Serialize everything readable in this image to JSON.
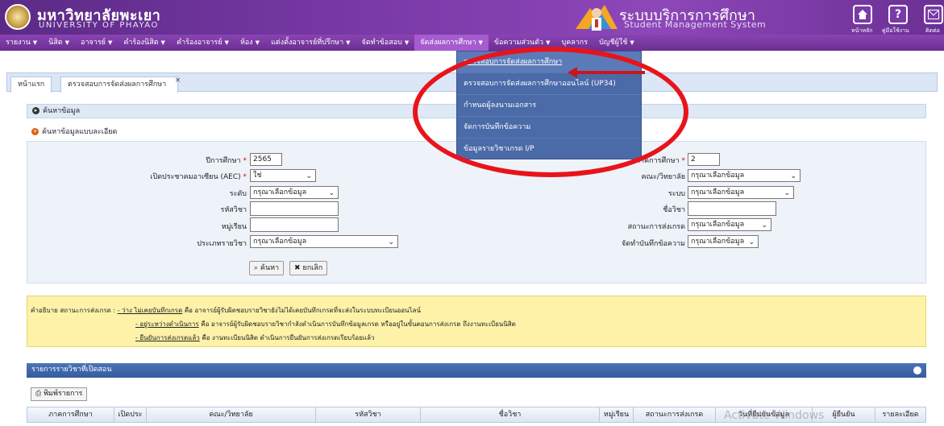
{
  "header": {
    "university_th": "มหาวิทยาลัยพะเยา",
    "university_en": "UNIVERSITY OF PHAYAO",
    "system_th": "ระบบบริการการศึกษา",
    "system_en": "Student Management System",
    "home_label": "หน้าหลัก",
    "manual_label": "คู่มือใช้งาน",
    "contact_label": "ติดต่อ",
    "help_glyph": "?"
  },
  "nav": {
    "items": [
      "รายงาน",
      "นิสิต",
      "อาจารย์",
      "คำร้องนิสิต",
      "คำร้องอาจารย์",
      "ห้อง",
      "แต่งตั้งอาจารย์ที่ปรึกษา",
      "จัดทำข้อสอบ",
      "จัดส่งผลการศึกษา",
      "ข้อความส่วนตัว",
      "บุคลากร",
      "บัญชีผู้ใช้"
    ]
  },
  "dropdown": {
    "items": [
      "ตรวจสอบการจัดส่งผลการศึกษา",
      "ตรวจสอบการจัดส่งผลการศึกษาออนไลน์ (UP34)",
      "กำหนดผู้ลงนามเอกสาร",
      "จัดการบันทึกข้อความ",
      "ข้อมูลรายวิชาเกรด I/P"
    ]
  },
  "tabs": {
    "home": "หน้าแรก",
    "current": "ตรวจสอบการจัดส่งผลการศึกษา",
    "close": "×"
  },
  "search": {
    "title": "ค้นหาข้อมูล",
    "advanced_title": "ค้นหาข้อมูลแบบละเอียด",
    "year_label": "ปีการศึกษา",
    "year_value": "2565",
    "aec_label": "เปิดประชาคมอาเซียน (AEC)",
    "aec_value": "ใช่",
    "level_label": "ระดับ",
    "course_code_label": "รหัสวิชา",
    "section_label": "หมู่เรียน",
    "course_type_label": "ประเภทรายวิชา",
    "semester_label": "ภาคการศึกษา",
    "semester_value": "2",
    "faculty_label": "คณะ/วิทยาลัย",
    "system_label": "ระบบ",
    "course_name_label": "ชื่อวิชา",
    "grade_status_label": "สถานะการส่งเกรด",
    "memo_label": "จัดทำบันทึกข้อความ",
    "select_placeholder": "กรุณาเลือกข้อมูล",
    "search_button": "ค้นหา",
    "cancel_button": "ยกเลิก",
    "required_mark": "*"
  },
  "legend": {
    "intro": "คำอธิบาย สถานะการส่งเกรด :",
    "line1_key": "- ว่าง ไม่เคยบันทึกเกรด",
    "line1_text": "คือ อาจารย์ผู้รับผิดชอบรายวิชายังไม่ได้เคยบันทึกเกรดที่จะส่งในระบบทะเบียนออนไลน์",
    "line2_key": "- อยู่ระหว่างดำเนินการ",
    "line2_text": "คือ อาจารย์ผู้รับผิดชอบรายวิชากำลังดำเนินการบันทึกข้อมูลเกรด หรืออยู่ในขั้นตอนการส่งเกรด ถึงงานทะเบียนนิสิต",
    "line3_key": "- ยืนยันการส่งเกรดแล้ว",
    "line3_text": "คือ งานทะเบียนนิสิต ดำเนินการยืนยันการส่งเกรดเรียบร้อยแล้ว"
  },
  "results": {
    "title": "รายการรายวิชาที่เปิดสอน",
    "print_button": "พิมพ์รายการ",
    "columns": [
      "ภาคการศึกษา",
      "เปิดประ",
      "คณะ/วิทยาลัย",
      "รหัสวิชา",
      "ชื่อวิชา",
      "หมู่เรียน",
      "สถานะการส่งเกรด",
      "วันที่ยืนยันข้อมูล",
      "ผู้ยืนยัน",
      "รายละเอียด"
    ]
  },
  "watermark": "Activate Windows",
  "colors": {
    "header_purple": "#7a3aa8",
    "dropdown_blue": "#4b6aa8",
    "annotation_red": "#e8141b",
    "legend_yellow": "#fdf2a8"
  }
}
